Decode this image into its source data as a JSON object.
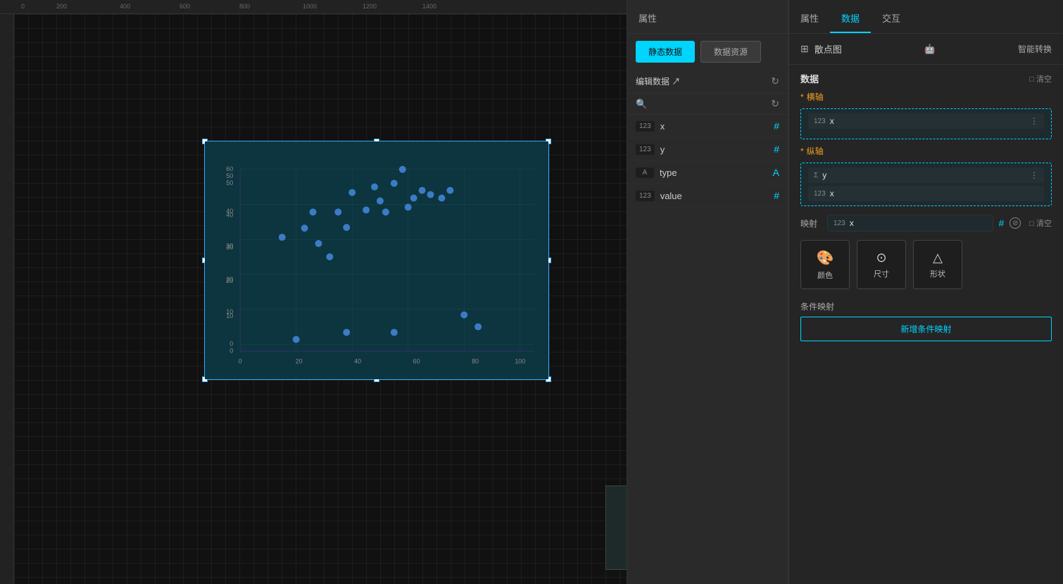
{
  "tabs": {
    "properties": "属性",
    "data": "数据",
    "interaction": "交互"
  },
  "datasource_tabs": {
    "static_data": "静态数据",
    "data_source": "数据资源"
  },
  "edit_data": {
    "label": "编辑数据 ↗"
  },
  "fields": [
    {
      "type": "123",
      "name": "x",
      "icon": "#",
      "icon_type": "hash"
    },
    {
      "type": "123",
      "name": "y",
      "icon": "#",
      "icon_type": "hash"
    },
    {
      "type": "A",
      "name": "type",
      "icon": "A",
      "icon_type": "alpha"
    },
    {
      "type": "123",
      "name": "value",
      "icon": "#",
      "icon_type": "hash"
    }
  ],
  "config": {
    "chart_icon": "⊞",
    "chart_name": "散点图",
    "smart_convert": "智能转换",
    "data_section": "数据",
    "clear_label": "□ 清空",
    "x_axis": {
      "label": "横轴",
      "required": true,
      "field": {
        "type": "123",
        "name": "x",
        "menu": "⋮"
      }
    },
    "y_axis": {
      "label": "纵轴",
      "required": true,
      "fields": [
        {
          "type": "Σ",
          "name": "y",
          "menu": "⋮"
        },
        {
          "type": "123",
          "name": "x"
        }
      ]
    },
    "mapping": {
      "label": "映射",
      "field_type": "123",
      "field_name": "x",
      "clear_label": "□ 清空"
    },
    "map_buttons": [
      {
        "icon": "🎨",
        "label": "颜色"
      },
      {
        "icon": "⊙",
        "label": "尺寸"
      },
      {
        "icon": "△",
        "label": "形状"
      }
    ],
    "condition_mapping": {
      "title": "条件映射",
      "add_label": "新增条件映射"
    }
  },
  "scatter_data": [
    {
      "x": 15,
      "y": 39
    },
    {
      "x": 20,
      "y": 1
    },
    {
      "x": 23,
      "y": 42
    },
    {
      "x": 26,
      "y": 45
    },
    {
      "x": 28,
      "y": 38
    },
    {
      "x": 32,
      "y": 30
    },
    {
      "x": 35,
      "y": 45
    },
    {
      "x": 38,
      "y": 40
    },
    {
      "x": 40,
      "y": 52
    },
    {
      "x": 45,
      "y": 46
    },
    {
      "x": 48,
      "y": 54
    },
    {
      "x": 50,
      "y": 48
    },
    {
      "x": 52,
      "y": 45
    },
    {
      "x": 55,
      "y": 55
    },
    {
      "x": 58,
      "y": 60
    },
    {
      "x": 60,
      "y": 47
    },
    {
      "x": 62,
      "y": 50
    },
    {
      "x": 65,
      "y": 53
    },
    {
      "x": 68,
      "y": 51
    },
    {
      "x": 72,
      "y": 50
    },
    {
      "x": 75,
      "y": 53
    },
    {
      "x": 80,
      "y": 15
    },
    {
      "x": 85,
      "y": 6
    },
    {
      "x": 55,
      "y": 2
    },
    {
      "x": 38,
      "y": 2
    }
  ],
  "ruler_marks": [
    "0",
    "200",
    "400",
    "600",
    "800",
    "1000",
    "1200",
    "1400"
  ]
}
